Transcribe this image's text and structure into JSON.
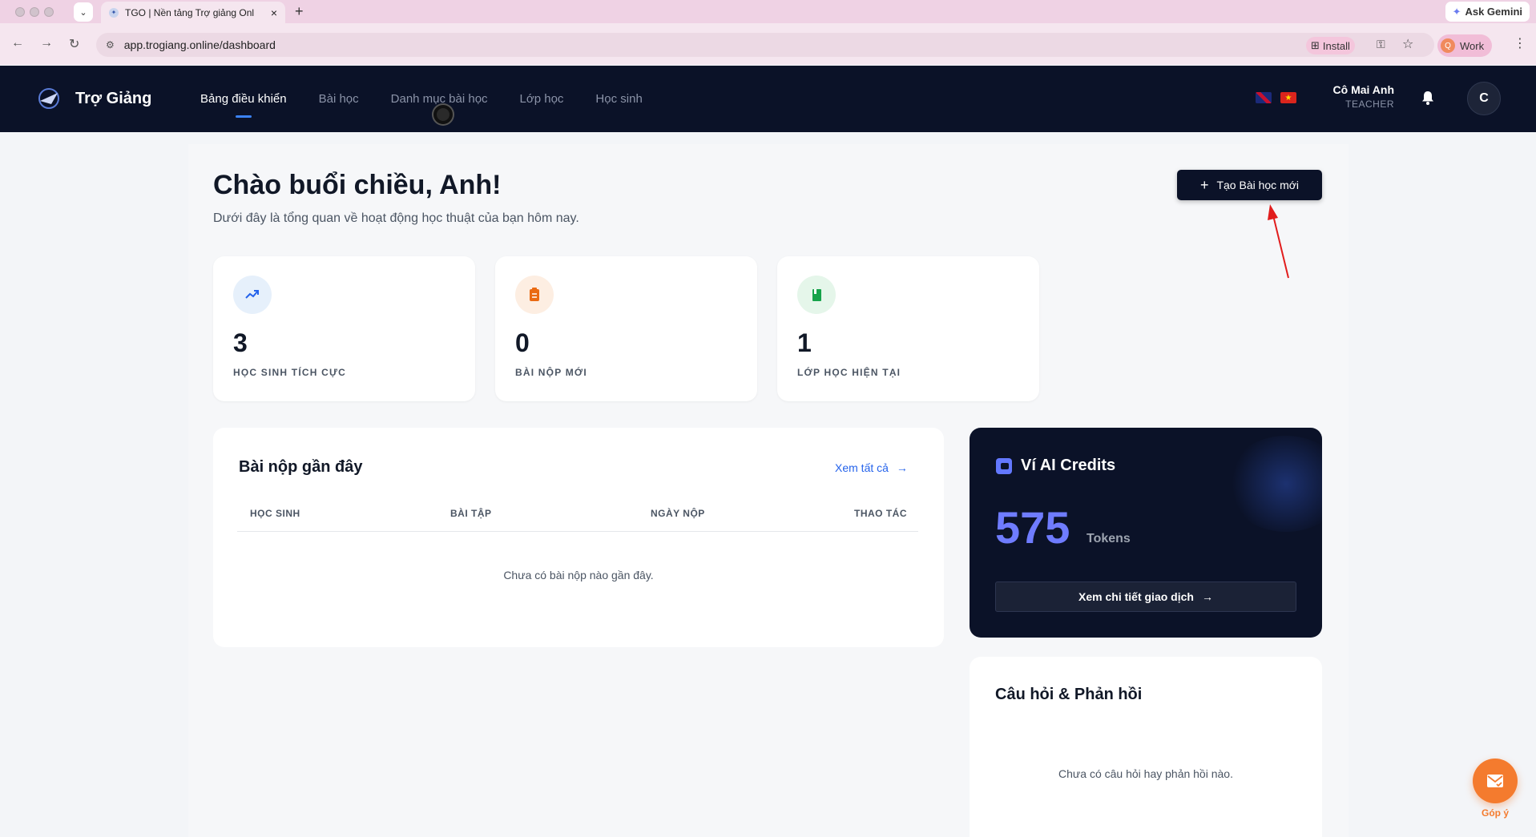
{
  "browser": {
    "tab_title": "TGO | Nền tảng Trợ giảng Onl",
    "url": "app.trogiang.online/dashboard",
    "install_label": "Install",
    "profile_label": "Work",
    "profile_initial": "Q",
    "gemini_label": "Ask Gemini"
  },
  "header": {
    "brand": "Trợ Giảng",
    "nav": [
      {
        "label": "Bảng điều khiển",
        "active": true
      },
      {
        "label": "Bài học"
      },
      {
        "label": "Danh mục bài học"
      },
      {
        "label": "Lớp học"
      },
      {
        "label": "Học sinh"
      }
    ],
    "user_name": "Cô Mai Anh",
    "user_role": "TEACHER",
    "avatar_initial": "C"
  },
  "main": {
    "greeting": "Chào buổi chiều, Anh!",
    "subtitle": "Dưới đây là tổng quan về hoạt động học thuật của bạn hôm nay.",
    "new_lesson_button": "Tạo Bài học mới",
    "stats": [
      {
        "value": "3",
        "label": "HỌC SINH TÍCH CỰC",
        "icon": "trending-up-icon",
        "color": "#2563eb",
        "bg": "#e6f0fb"
      },
      {
        "value": "0",
        "label": "BÀI NỘP MỚI",
        "icon": "clipboard-icon",
        "color": "#ea6a12",
        "bg": "#fdeee2"
      },
      {
        "value": "1",
        "label": "LỚP HỌC HIỆN TẠI",
        "icon": "book-icon",
        "color": "#16a34a",
        "bg": "#e5f6ea"
      }
    ],
    "recent": {
      "title": "Bài nộp gần đây",
      "see_all": "Xem tất cả",
      "columns": [
        "HỌC SINH",
        "BÀI TẬP",
        "NGÀY NỘP",
        "THAO TÁC"
      ],
      "empty": "Chưa có bài nộp nào gần đây."
    },
    "wallet": {
      "title": "Ví AI Credits",
      "amount": "575",
      "unit": "Tokens",
      "button": "Xem chi tiết giao dịch"
    },
    "qa": {
      "title": "Câu hỏi & Phản hồi",
      "empty": "Chưa có câu hỏi hay phản hồi nào."
    },
    "feedback_label": "Góp ý"
  }
}
